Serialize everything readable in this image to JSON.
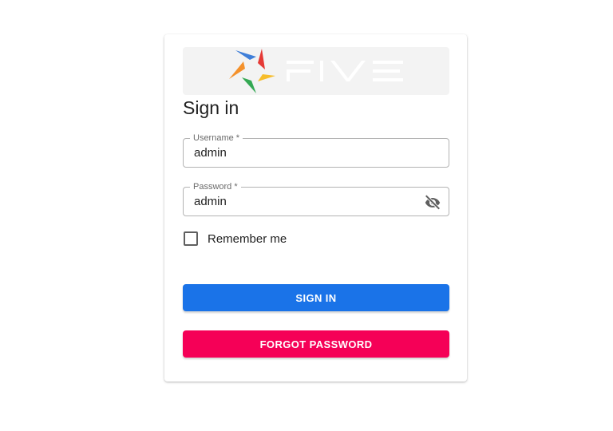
{
  "brand": {
    "name": "FIVE",
    "colors": {
      "blue": "#3f7fd9",
      "red": "#e53935",
      "orange": "#f4912b",
      "yellow": "#f6bd2b",
      "green": "#34a853"
    }
  },
  "form": {
    "title": "Sign in",
    "username": {
      "label": "Username *",
      "value": "admin"
    },
    "password": {
      "label": "Password *",
      "value": "admin",
      "visibility_icon": "visibility-off-icon"
    },
    "remember": {
      "label": "Remember me",
      "checked": false
    },
    "sign_in_label": "SIGN IN",
    "forgot_label": "FORGOT PASSWORD"
  },
  "colors": {
    "primary": "#1a73e8",
    "secondary": "#f50057"
  }
}
